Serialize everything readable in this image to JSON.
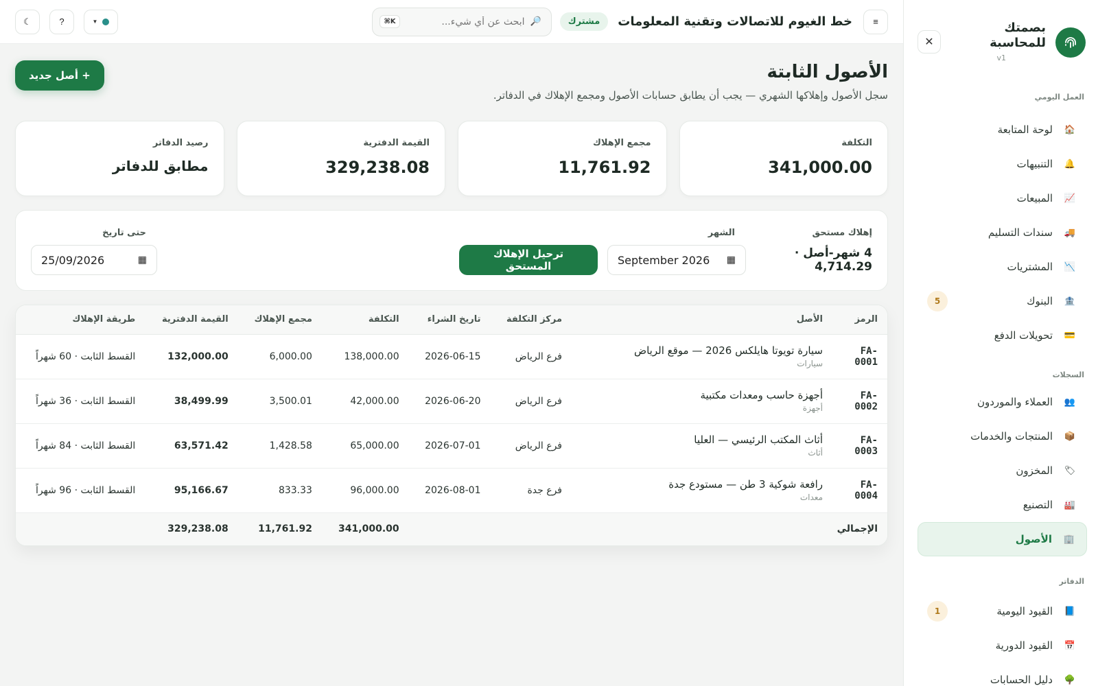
{
  "sidebar": {
    "brand_name": "بصمتك للمحاسبة",
    "version": "v1",
    "sections": {
      "daily": "العمل اليومي",
      "records": "السجلات",
      "books": "الدفاتر"
    },
    "items": [
      {
        "label": "لوحة المتابعة",
        "icon": "🏠"
      },
      {
        "label": "التنبيهات",
        "icon": "🔔"
      },
      {
        "label": "المبيعات",
        "icon": "📈"
      },
      {
        "label": "سندات التسليم",
        "icon": "🚚"
      },
      {
        "label": "المشتريات",
        "icon": "📉"
      },
      {
        "label": "البنوك",
        "icon": "🏦",
        "badge": "5"
      },
      {
        "label": "تحويلات الدفع",
        "icon": "💳"
      },
      {
        "label": "العملاء والموردون",
        "icon": "👥"
      },
      {
        "label": "المنتجات والخدمات",
        "icon": "📦"
      },
      {
        "label": "المخزون",
        "icon": "🏷"
      },
      {
        "label": "التصنيع",
        "icon": "🏭"
      },
      {
        "label": "الأصول",
        "icon": "🏢"
      },
      {
        "label": "القيود اليومية",
        "icon": "📘",
        "badge": "1"
      },
      {
        "label": "القيود الدورية",
        "icon": "📅"
      },
      {
        "label": "دليل الحسابات",
        "icon": "🌳"
      }
    ]
  },
  "topbar": {
    "company": "خط الغيوم للاتصالات وتقنية المعلومات",
    "plan": "مشترك",
    "search_placeholder": "ابحث عن أي شيء...",
    "shortcut": "K⌘",
    "help": "?"
  },
  "page": {
    "title": "الأصول الثابتة",
    "subtitle": "سجل الأصول وإهلاكها الشهري — يجب أن يطابق حسابات الأصول ومجمع الإهلاك في الدفاتر.",
    "new_button": "+ أصل جديد"
  },
  "cards": [
    {
      "label": "التكلفة",
      "value": "341,000.00"
    },
    {
      "label": "مجمع الإهلاك",
      "value": "11,761.92"
    },
    {
      "label": "القيمة الدفترية",
      "value": "329,238.08"
    },
    {
      "label": "رصيد الدفاتر",
      "value": "مطابق للدفاتر"
    }
  ],
  "depreciation": {
    "due_label": "إهلاك مستحق",
    "due_value": "4 شهر-أصل · 4,714.29",
    "month_label": "الشهر",
    "month_value": "September 2026",
    "post_button": "ترحيل الإهلاك المستحق",
    "until_label": "حتى تاريخ",
    "until_value": "25/09/2026"
  },
  "table": {
    "headers": [
      "الرمز",
      "الأصل",
      "مركز التكلفة",
      "تاريخ الشراء",
      "التكلفة",
      "مجمع الإهلاك",
      "القيمة الدفترية",
      "طريقة الإهلاك"
    ],
    "rows": [
      {
        "code": "FA-0001",
        "name": "سيارة تويوتا هايلكس 2026 — موقع الرياض",
        "category": "سيارات",
        "center": "فرع الرياض",
        "date": "2026-06-15",
        "cost": "138,000.00",
        "accum": "6,000.00",
        "book": "132,000.00",
        "method": "القسط الثابت · 60 شهراً"
      },
      {
        "code": "FA-0002",
        "name": "أجهزة حاسب ومعدات مكتبية",
        "category": "أجهزة",
        "center": "فرع الرياض",
        "date": "2026-06-20",
        "cost": "42,000.00",
        "accum": "3,500.01",
        "book": "38,499.99",
        "method": "القسط الثابت · 36 شهراً"
      },
      {
        "code": "FA-0003",
        "name": "أثاث المكتب الرئيسي — العليا",
        "category": "أثاث",
        "center": "فرع الرياض",
        "date": "2026-07-01",
        "cost": "65,000.00",
        "accum": "1,428.58",
        "book": "63,571.42",
        "method": "القسط الثابت · 84 شهراً"
      },
      {
        "code": "FA-0004",
        "name": "رافعة شوكية 3 طن — مستودع جدة",
        "category": "معدات",
        "center": "فرع جدة",
        "date": "2026-08-01",
        "cost": "96,000.00",
        "accum": "833.33",
        "book": "95,166.67",
        "method": "القسط الثابت · 96 شهراً"
      }
    ],
    "total": {
      "label": "الإجمالي",
      "cost": "341,000.00",
      "accum": "11,761.92",
      "book": "329,238.08"
    }
  },
  "colors": {
    "accent": "#1e7a46",
    "accent_light": "#e8f4ec",
    "badge": "#fbf0dc"
  }
}
